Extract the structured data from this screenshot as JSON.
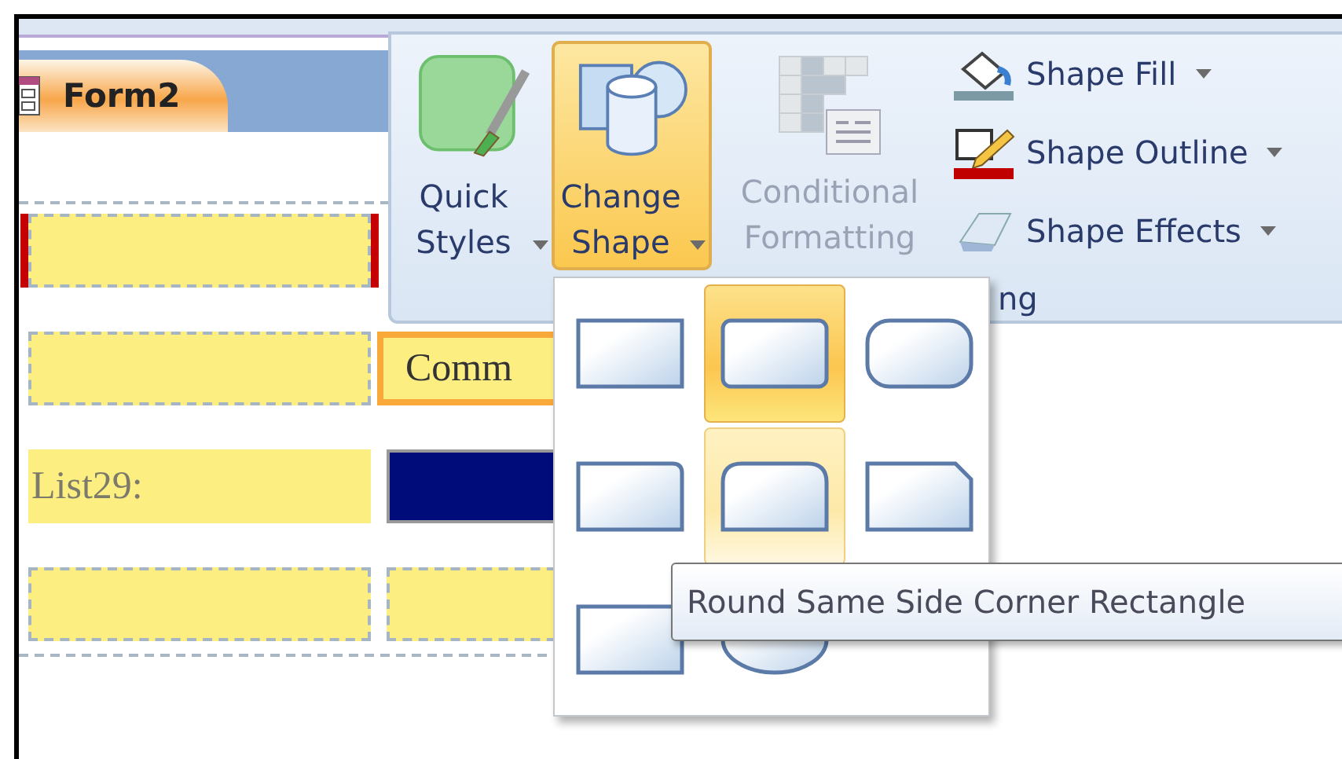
{
  "document_tab": {
    "label": "Form2",
    "selected": true
  },
  "form": {
    "rows": [
      {
        "cells": [
          {
            "kind": "box",
            "selected": true
          }
        ]
      },
      {
        "cells": [
          {
            "kind": "box",
            "selected": false
          },
          {
            "kind": "textbox",
            "text": "Comm",
            "selected": false
          }
        ]
      },
      {
        "cells": [
          {
            "kind": "label",
            "text": "List29:",
            "selected": false
          },
          {
            "kind": "listbox",
            "selected": false
          }
        ]
      },
      {
        "cells": [
          {
            "kind": "box",
            "selected": false
          },
          {
            "kind": "box",
            "selected": false
          }
        ]
      }
    ]
  },
  "ribbon": {
    "large_buttons": [
      {
        "kind": "quick-styles",
        "label": "Quick Styles",
        "dropdown": true,
        "pressed": false,
        "disabled": false
      },
      {
        "kind": "change-shape",
        "label": "Change Shape",
        "dropdown": true,
        "pressed": true,
        "disabled": false
      },
      {
        "kind": "conditional-formatting",
        "label": "Conditional Formatting",
        "dropdown": false,
        "pressed": false,
        "disabled": true
      }
    ],
    "small_buttons": [
      {
        "kind": "fill",
        "label": "Shape Fill",
        "dropdown": true
      },
      {
        "kind": "outline",
        "label": "Shape Outline",
        "dropdown": true
      },
      {
        "kind": "effects",
        "label": "Shape Effects",
        "dropdown": true
      }
    ],
    "group_label": "ng"
  },
  "shape_gallery": {
    "items": [
      {
        "kind": "rectangle",
        "selected": false,
        "hovered": false
      },
      {
        "kind": "rounded-rectangle",
        "selected": true,
        "hovered": false
      },
      {
        "kind": "rounded-rectangle-large",
        "selected": false,
        "hovered": false
      },
      {
        "kind": "round-single-corner",
        "selected": false,
        "hovered": false
      },
      {
        "kind": "round-same-side",
        "selected": false,
        "hovered": true
      },
      {
        "kind": "snip-single-corner",
        "selected": false,
        "hovered": false
      },
      {
        "kind": "rectangle",
        "selected": false,
        "hovered": false
      },
      {
        "kind": "ellipse",
        "selected": false,
        "hovered": false
      }
    ]
  },
  "tooltip": {
    "text": "Round Same Side Corner Rectangle"
  }
}
